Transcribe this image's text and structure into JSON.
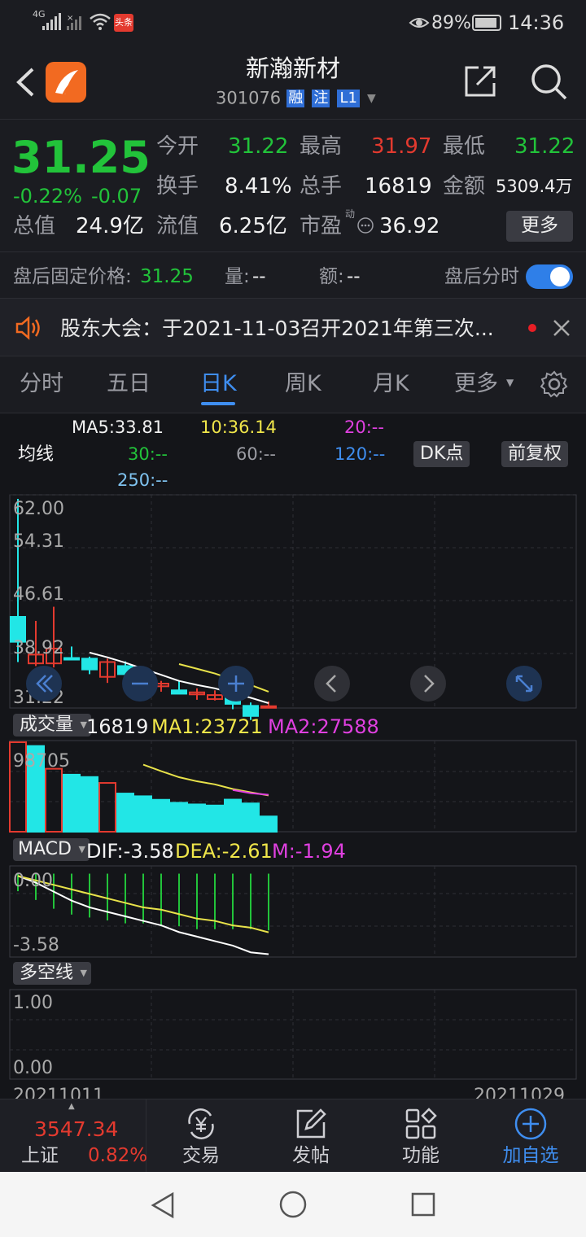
{
  "status_bar": {
    "network": "4G",
    "battery": "89%",
    "time": "14:36",
    "app_badge": "头条"
  },
  "header": {
    "title": "新瀚新材",
    "code": "301076",
    "badges": [
      "融",
      "注",
      "L1"
    ]
  },
  "quote": {
    "price": "31.25",
    "change_pct": "-0.22%",
    "change": "-0.07",
    "fields": [
      {
        "label": "今开",
        "value": "31.22"
      },
      {
        "label": "最高",
        "value": "31.97"
      },
      {
        "label": "最低",
        "value": "31.22"
      },
      {
        "label": "换手",
        "value": "8.41%"
      },
      {
        "label": "总手",
        "value": "16819"
      },
      {
        "label": "金额",
        "value": "5309.4万"
      },
      {
        "label": "总值",
        "value": "24.9亿"
      },
      {
        "label": "流值",
        "value": "6.25亿"
      },
      {
        "label": "市盈",
        "value": "36.92"
      }
    ],
    "pe_tag": "动",
    "more_button": "更多",
    "after_hours": {
      "label": "盘后固定价格:",
      "price": "31.25",
      "vol_label": "量:",
      "vol": "--",
      "amt_label": "额:",
      "amt": "--",
      "toggle_label": "盘后分时",
      "toggle_on": true
    }
  },
  "notice": {
    "text": "股东大会：于2021-11-03召开2021年第三次..."
  },
  "tabs": {
    "items": [
      "分时",
      "五日",
      "日K",
      "周K",
      "月K",
      "更多"
    ],
    "active": "日K"
  },
  "ma_legend": {
    "ma5": "MA5:33.81",
    "time": "10:36.14",
    "ma20": "20:--",
    "label": "均线",
    "ma30": "30:--",
    "ma60": "60:--",
    "ma120": "120:--",
    "ma250": "250:--",
    "dk_button": "DK点",
    "fq_button": "前复权"
  },
  "price_axis": [
    "62.00",
    "54.31",
    "46.61",
    "38.92",
    "31.22"
  ],
  "volume": {
    "selector": "成交量",
    "value": "16819",
    "ma1": "MA1:23721",
    "ma2": "MA2:27588",
    "axis_top": "98705"
  },
  "macd": {
    "selector": "MACD",
    "dif": "DIF:-3.58",
    "dea": "DEA:-2.61",
    "m": "M:-1.94",
    "axis_top": "0.00",
    "axis_bottom": "-3.58"
  },
  "multi": {
    "selector": "多空线",
    "axis_top": "1.00",
    "axis_bottom": "0.00"
  },
  "dates": {
    "start": "20211011",
    "end": "20211029"
  },
  "chart_data": {
    "type": "candlestick",
    "candles": [
      {
        "o": 44.5,
        "h": 62.0,
        "l": 37.8,
        "c": 40.8,
        "dir": "down"
      },
      {
        "o": 37.6,
        "h": 43.9,
        "l": 37.2,
        "c": 38.9,
        "dir": "up"
      },
      {
        "o": 37.6,
        "h": 46.0,
        "l": 37.0,
        "c": 39.8,
        "dir": "up"
      },
      {
        "o": 38.4,
        "h": 40.1,
        "l": 38.2,
        "c": 38.4,
        "dir": "down"
      },
      {
        "o": 38.3,
        "h": 38.6,
        "l": 36.0,
        "c": 36.7,
        "dir": "down"
      },
      {
        "o": 35.6,
        "h": 38.3,
        "l": 34.7,
        "c": 37.8,
        "dir": "up"
      },
      {
        "o": 37.2,
        "h": 37.9,
        "l": 35.5,
        "c": 36.0,
        "dir": "down"
      },
      {
        "o": 35.7,
        "h": 36.4,
        "l": 34.8,
        "c": 35.0,
        "dir": "down"
      },
      {
        "o": 34.2,
        "h": 35.0,
        "l": 33.4,
        "c": 34.6,
        "dir": "up"
      },
      {
        "o": 33.6,
        "h": 34.9,
        "l": 33.2,
        "c": 33.1,
        "dir": "down"
      },
      {
        "o": 33.0,
        "h": 33.9,
        "l": 32.2,
        "c": 33.3,
        "dir": "up"
      },
      {
        "o": 32.3,
        "h": 33.6,
        "l": 32.1,
        "c": 32.9,
        "dir": "up"
      },
      {
        "o": 33.2,
        "h": 34.8,
        "l": 30.8,
        "c": 31.6,
        "dir": "down"
      },
      {
        "o": 31.3,
        "h": 31.8,
        "l": 29.2,
        "c": 29.8,
        "dir": "down"
      },
      {
        "o": 31.22,
        "h": 31.97,
        "l": 31.22,
        "c": 31.25,
        "dir": "up"
      }
    ],
    "ma5": [
      null,
      null,
      null,
      null,
      39.2,
      38.5,
      37.7,
      36.8,
      35.9,
      35.0,
      34.4,
      33.9,
      33.2,
      32.5,
      31.7
    ],
    "ma10": [
      null,
      null,
      null,
      null,
      null,
      null,
      null,
      null,
      null,
      37.5,
      36.8,
      36.1,
      35.2,
      34.4,
      33.4
    ],
    "volumes": [
      98705,
      94500,
      69400,
      62900,
      60300,
      53800,
      42100,
      39100,
      35200,
      31900,
      30100,
      28900,
      35400,
      31200,
      16819
    ],
    "vol_ma1": [
      null,
      null,
      null,
      null,
      null,
      null,
      null,
      74000,
      66800,
      60100,
      55600,
      52200,
      47100,
      43400,
      40000
    ],
    "vol_ma2": [
      null,
      null,
      null,
      null,
      null,
      null,
      null,
      null,
      null,
      null,
      null,
      null,
      46000,
      42500,
      40700
    ],
    "dif": [
      -0.1,
      -0.4,
      -0.8,
      -1.2,
      -1.5,
      -1.7,
      -1.9,
      -2.1,
      -2.3,
      -2.6,
      -2.8,
      -3.0,
      -3.2,
      -3.5,
      -3.58
    ],
    "dea": [
      -0.1,
      -0.3,
      -0.5,
      -0.7,
      -0.9,
      -1.1,
      -1.3,
      -1.5,
      -1.6,
      -1.8,
      -2.0,
      -2.1,
      -2.3,
      -2.4,
      -2.61
    ],
    "macd_bars": [
      -0.6,
      -0.9,
      -1.2,
      -1.4,
      -1.5,
      -1.6,
      -1.7,
      -1.7,
      -1.8,
      -1.8,
      -1.9,
      -1.9,
      -1.9,
      -1.9,
      -1.94
    ],
    "price_range": [
      31.22,
      62.0
    ]
  },
  "bottom_nav": {
    "index_value": "3547.34",
    "index_name": "上证",
    "index_change": "0.82%",
    "items": [
      {
        "label": "交易",
        "icon": "yen-cycle-icon"
      },
      {
        "label": "发帖",
        "icon": "edit-icon"
      },
      {
        "label": "功能",
        "icon": "grid-icon"
      },
      {
        "label": "加自选",
        "icon": "plus-circle-icon"
      }
    ]
  },
  "colors": {
    "up": "#e33a2f",
    "down": "#22e6e6",
    "ma5": "#ffffff",
    "ma10": "#e8e24a",
    "ma20": "#e040e0",
    "accent": "#2f7fe8"
  }
}
